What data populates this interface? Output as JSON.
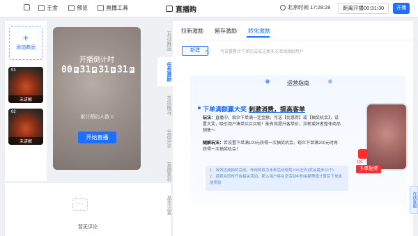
{
  "topbar": {
    "fullscreen_icon": "expand-icon",
    "shop": "王金",
    "preview": "预览",
    "live_tools": "直播工具",
    "title": "直播购",
    "beijing_time": "北京时间 17:28:28",
    "countdown": "距离开播00:31:30",
    "start": "开播"
  },
  "left": {
    "add_product": "添加商品",
    "products": [
      {
        "index": "01",
        "status": "未讲解"
      },
      {
        "index": "02",
        "status": "未讲解"
      }
    ]
  },
  "phone": {
    "countdown_title": "开播倒计时",
    "days": "00",
    "day_unit": "日",
    "hours": "31",
    "hour_unit": "时",
    "minutes": "31",
    "minute_unit": "分",
    "seconds": "31",
    "second_unit": "秒",
    "reserve": "累计预约人数  0",
    "go_live": "开始直播"
  },
  "comments": {
    "empty": "暂无评论"
  },
  "vtabs": [
    "互动推送",
    "任务激励",
    "本场概况",
    "全部评论",
    "直播素材",
    "基本设置"
  ],
  "right": {
    "tabs": [
      "拉新激励",
      "留存激励",
      "转化激励"
    ],
    "new_button": "新建",
    "hint": "可设置累计下单完成成这类多次活动激励用户",
    "guide_title": "运营指南",
    "headline_blue": "下单满额赢大奖",
    "headline_dark": "刺激消费，提高客单",
    "para1_label": "玩法：",
    "para1": "直播中，观众下单满一定金额，可送【优惠券】或【抽奖机会】，设置大奖，吸引用户凑单买买买呢！能有效提升客单价，拉新爱好者整体商品销售～",
    "para2_label": "随解玩法：",
    "para2": "若设置下单满100元获得一次抽奖机会，观众下单满200元时再获得一次抽奖机会！",
    "tip1": "1、有效达成抽奖活动，作用将成为未来活动规划10%左右(奖品最多10个)",
    "tip2": "2、若观众同时开启相关活动，那么用户将在多活动中的金额等值计算后下单发放奖励",
    "gift_price": "100",
    "draw_badge": "下单抽奖",
    "float_tab": "在线客服"
  }
}
